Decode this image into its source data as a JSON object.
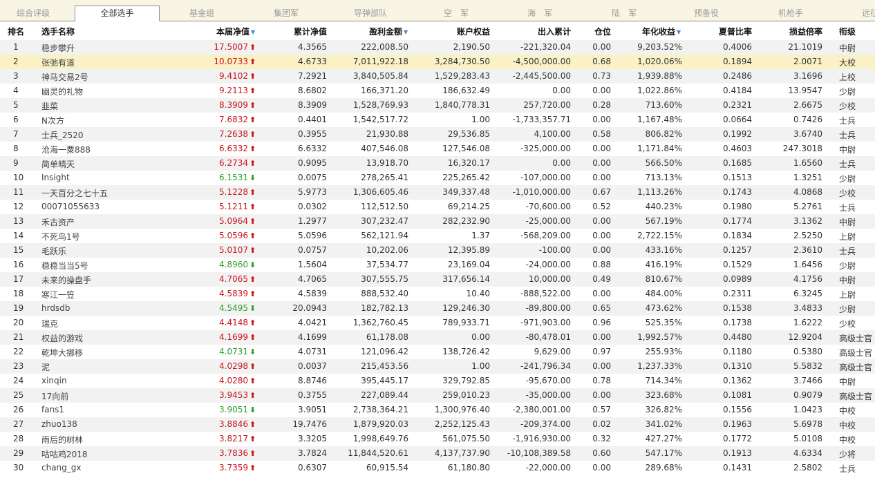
{
  "tabs": [
    {
      "label": "综合评级",
      "active": false
    },
    {
      "label": "全部选手",
      "active": true
    },
    {
      "label": "基金组",
      "active": false
    },
    {
      "label": "集团军",
      "active": false
    },
    {
      "label": "导弹部队",
      "active": false
    },
    {
      "label": "空　军",
      "active": false
    },
    {
      "label": "海　军",
      "active": false
    },
    {
      "label": "陆　军",
      "active": false
    },
    {
      "label": "预备役",
      "active": false
    },
    {
      "label": "机枪手",
      "active": false
    },
    {
      "label": "远征",
      "active": false
    }
  ],
  "columns": {
    "rank": "排名",
    "name": "选手名称",
    "nav": "本届净值",
    "cum_nav": "累计净值",
    "profit": "盈利金额",
    "equity": "账户权益",
    "withdraw": "出入累计",
    "position": "仓位",
    "annual": "年化收益",
    "sharpe": "夏普比率",
    "pl_ratio": "损益倍率",
    "rank_title": "衔级"
  },
  "sorted_columns": [
    "nav",
    "profit",
    "annual"
  ],
  "colors": {
    "up": "#c8161d",
    "down": "#2e9e2e",
    "highlight": "#fbf1c6",
    "sort": "#3c8dde"
  },
  "rows": [
    {
      "rank": "1",
      "name": "稳步攀升",
      "nav": "17.5007",
      "trend": "up",
      "cum_nav": "4.3565",
      "profit": "222,008.50",
      "equity": "2,190.50",
      "withdraw": "-221,320.04",
      "position": "0.00",
      "annual": "9,203.52%",
      "sharpe": "0.4006",
      "pl_ratio": "21.1019",
      "rank_title": "中尉"
    },
    {
      "rank": "2",
      "name": "张弛有道",
      "nav": "10.0733",
      "trend": "up",
      "cum_nav": "4.6733",
      "profit": "7,011,922.18",
      "equity": "3,284,730.50",
      "withdraw": "-4,500,000.00",
      "position": "0.68",
      "annual": "1,020.06%",
      "sharpe": "0.1894",
      "pl_ratio": "2.0071",
      "rank_title": "大校"
    },
    {
      "rank": "3",
      "name": "神马交易2号",
      "nav": "9.4102",
      "trend": "up",
      "cum_nav": "7.2921",
      "profit": "3,840,505.84",
      "equity": "1,529,283.43",
      "withdraw": "-2,445,500.00",
      "position": "0.73",
      "annual": "1,939.88%",
      "sharpe": "0.2486",
      "pl_ratio": "3.1696",
      "rank_title": "上校"
    },
    {
      "rank": "4",
      "name": "幽灵的礼物",
      "nav": "9.2113",
      "trend": "up",
      "cum_nav": "8.6802",
      "profit": "166,371.20",
      "equity": "186,632.49",
      "withdraw": "0.00",
      "position": "0.00",
      "annual": "1,022.86%",
      "sharpe": "0.4184",
      "pl_ratio": "13.9547",
      "rank_title": "少尉"
    },
    {
      "rank": "5",
      "name": "韭菜",
      "nav": "8.3909",
      "trend": "up",
      "cum_nav": "8.3909",
      "profit": "1,528,769.93",
      "equity": "1,840,778.31",
      "withdraw": "257,720.00",
      "position": "0.28",
      "annual": "713.60%",
      "sharpe": "0.2321",
      "pl_ratio": "2.6675",
      "rank_title": "少校"
    },
    {
      "rank": "6",
      "name": "N次方",
      "nav": "7.6832",
      "trend": "up",
      "cum_nav": "0.4401",
      "profit": "1,542,517.72",
      "equity": "1.00",
      "withdraw": "-1,733,357.71",
      "position": "0.00",
      "annual": "1,167.48%",
      "sharpe": "0.0664",
      "pl_ratio": "0.7426",
      "rank_title": "士兵"
    },
    {
      "rank": "7",
      "name": "士兵_2520",
      "nav": "7.2638",
      "trend": "up",
      "cum_nav": "0.3955",
      "profit": "21,930.88",
      "equity": "29,536.85",
      "withdraw": "4,100.00",
      "position": "0.58",
      "annual": "806.82%",
      "sharpe": "0.1992",
      "pl_ratio": "3.6740",
      "rank_title": "士兵"
    },
    {
      "rank": "8",
      "name": "沧海一粟888",
      "nav": "6.6332",
      "trend": "up",
      "cum_nav": "6.6332",
      "profit": "407,546.08",
      "equity": "127,546.08",
      "withdraw": "-325,000.00",
      "position": "0.00",
      "annual": "1,171.84%",
      "sharpe": "0.4603",
      "pl_ratio": "247.3018",
      "rank_title": "中尉"
    },
    {
      "rank": "9",
      "name": "简单晴天",
      "nav": "6.2734",
      "trend": "up",
      "cum_nav": "0.9095",
      "profit": "13,918.70",
      "equity": "16,320.17",
      "withdraw": "0.00",
      "position": "0.00",
      "annual": "566.50%",
      "sharpe": "0.1685",
      "pl_ratio": "1.6560",
      "rank_title": "士兵"
    },
    {
      "rank": "10",
      "name": "Insight",
      "nav": "6.1531",
      "trend": "down",
      "cum_nav": "0.0075",
      "profit": "278,265.41",
      "equity": "225,265.42",
      "withdraw": "-107,000.00",
      "position": "0.00",
      "annual": "713.13%",
      "sharpe": "0.1513",
      "pl_ratio": "1.3251",
      "rank_title": "少尉"
    },
    {
      "rank": "11",
      "name": "一天百分之七十五",
      "nav": "5.1228",
      "trend": "up",
      "cum_nav": "5.9773",
      "profit": "1,306,605.46",
      "equity": "349,337.48",
      "withdraw": "-1,010,000.00",
      "position": "0.67",
      "annual": "1,113.26%",
      "sharpe": "0.1743",
      "pl_ratio": "4.0868",
      "rank_title": "少校"
    },
    {
      "rank": "12",
      "name": "00071055633",
      "nav": "5.1211",
      "trend": "up",
      "cum_nav": "0.0302",
      "profit": "112,512.50",
      "equity": "69,214.25",
      "withdraw": "-70,600.00",
      "position": "0.52",
      "annual": "440.23%",
      "sharpe": "0.1980",
      "pl_ratio": "5.2761",
      "rank_title": "士兵"
    },
    {
      "rank": "13",
      "name": "禾古资产",
      "nav": "5.0964",
      "trend": "up",
      "cum_nav": "1.2977",
      "profit": "307,232.47",
      "equity": "282,232.90",
      "withdraw": "-25,000.00",
      "position": "0.00",
      "annual": "567.19%",
      "sharpe": "0.1774",
      "pl_ratio": "3.1362",
      "rank_title": "中尉"
    },
    {
      "rank": "14",
      "name": "不死鸟1号",
      "nav": "5.0596",
      "trend": "up",
      "cum_nav": "5.0596",
      "profit": "562,121.94",
      "equity": "1.37",
      "withdraw": "-568,209.00",
      "position": "0.00",
      "annual": "2,722.15%",
      "sharpe": "0.1834",
      "pl_ratio": "2.5250",
      "rank_title": "上尉"
    },
    {
      "rank": "15",
      "name": "毛跃乐",
      "nav": "5.0107",
      "trend": "up",
      "cum_nav": "0.0757",
      "profit": "10,202.06",
      "equity": "12,395.89",
      "withdraw": "-100.00",
      "position": "0.00",
      "annual": "433.16%",
      "sharpe": "0.1257",
      "pl_ratio": "2.3610",
      "rank_title": "士兵"
    },
    {
      "rank": "16",
      "name": "稳稳当当5号",
      "nav": "4.8960",
      "trend": "down",
      "cum_nav": "1.5604",
      "profit": "37,534.77",
      "equity": "23,169.04",
      "withdraw": "-24,000.00",
      "position": "0.88",
      "annual": "416.19%",
      "sharpe": "0.1529",
      "pl_ratio": "1.6456",
      "rank_title": "少尉"
    },
    {
      "rank": "17",
      "name": "未来的操盘手",
      "nav": "4.7065",
      "trend": "up",
      "cum_nav": "4.7065",
      "profit": "307,555.75",
      "equity": "317,656.14",
      "withdraw": "10,000.00",
      "position": "0.49",
      "annual": "810.67%",
      "sharpe": "0.0989",
      "pl_ratio": "4.1756",
      "rank_title": "中尉"
    },
    {
      "rank": "18",
      "name": "寒江一笠",
      "nav": "4.5839",
      "trend": "up",
      "cum_nav": "4.5839",
      "profit": "888,532.40",
      "equity": "10.40",
      "withdraw": "-888,522.00",
      "position": "0.00",
      "annual": "484.00%",
      "sharpe": "0.2311",
      "pl_ratio": "6.3245",
      "rank_title": "上尉"
    },
    {
      "rank": "19",
      "name": "hrdsdb",
      "nav": "4.5495",
      "trend": "down",
      "cum_nav": "20.0943",
      "profit": "182,782.13",
      "equity": "129,246.30",
      "withdraw": "-89,800.00",
      "position": "0.65",
      "annual": "473.62%",
      "sharpe": "0.1538",
      "pl_ratio": "3.4833",
      "rank_title": "少尉"
    },
    {
      "rank": "20",
      "name": "瑞克",
      "nav": "4.4148",
      "trend": "up",
      "cum_nav": "4.0421",
      "profit": "1,362,760.45",
      "equity": "789,933.71",
      "withdraw": "-971,903.00",
      "position": "0.96",
      "annual": "525.35%",
      "sharpe": "0.1738",
      "pl_ratio": "1.6222",
      "rank_title": "少校"
    },
    {
      "rank": "21",
      "name": "权益的游戏",
      "nav": "4.1699",
      "trend": "up",
      "cum_nav": "4.1699",
      "profit": "61,178.08",
      "equity": "0.00",
      "withdraw": "-80,478.01",
      "position": "0.00",
      "annual": "1,992.57%",
      "sharpe": "0.4480",
      "pl_ratio": "12.9204",
      "rank_title": "高级士官"
    },
    {
      "rank": "22",
      "name": "乾坤大挪移",
      "nav": "4.0731",
      "trend": "down",
      "cum_nav": "4.0731",
      "profit": "121,096.42",
      "equity": "138,726.42",
      "withdraw": "9,629.00",
      "position": "0.97",
      "annual": "255.93%",
      "sharpe": "0.1180",
      "pl_ratio": "0.5380",
      "rank_title": "高级士官"
    },
    {
      "rank": "23",
      "name": "泥",
      "nav": "4.0298",
      "trend": "up",
      "cum_nav": "0.0037",
      "profit": "215,453.56",
      "equity": "1.00",
      "withdraw": "-241,796.34",
      "position": "0.00",
      "annual": "1,237.33%",
      "sharpe": "0.1310",
      "pl_ratio": "5.5832",
      "rank_title": "高级士官"
    },
    {
      "rank": "24",
      "name": "xinqin",
      "nav": "4.0280",
      "trend": "up",
      "cum_nav": "8.8746",
      "profit": "395,445.17",
      "equity": "329,792.85",
      "withdraw": "-95,670.00",
      "position": "0.78",
      "annual": "714.34%",
      "sharpe": "0.1362",
      "pl_ratio": "3.7466",
      "rank_title": "中尉"
    },
    {
      "rank": "25",
      "name": "17向前",
      "nav": "3.9453",
      "trend": "up",
      "cum_nav": "0.3755",
      "profit": "227,089.44",
      "equity": "259,010.23",
      "withdraw": "-35,000.00",
      "position": "0.00",
      "annual": "323.68%",
      "sharpe": "0.1081",
      "pl_ratio": "0.9079",
      "rank_title": "高级士官"
    },
    {
      "rank": "26",
      "name": "fans1",
      "nav": "3.9051",
      "trend": "down",
      "cum_nav": "3.9051",
      "profit": "2,738,364.21",
      "equity": "1,300,976.40",
      "withdraw": "-2,380,001.00",
      "position": "0.57",
      "annual": "326.82%",
      "sharpe": "0.1556",
      "pl_ratio": "1.0423",
      "rank_title": "中校"
    },
    {
      "rank": "27",
      "name": "zhuo138",
      "nav": "3.8846",
      "trend": "up",
      "cum_nav": "19.7476",
      "profit": "1,879,920.03",
      "equity": "2,252,125.43",
      "withdraw": "-209,374.00",
      "position": "0.02",
      "annual": "341.02%",
      "sharpe": "0.1963",
      "pl_ratio": "5.6978",
      "rank_title": "中校"
    },
    {
      "rank": "28",
      "name": "雨后的树林",
      "nav": "3.8217",
      "trend": "up",
      "cum_nav": "3.3205",
      "profit": "1,998,649.76",
      "equity": "561,075.50",
      "withdraw": "-1,916,930.00",
      "position": "0.32",
      "annual": "427.27%",
      "sharpe": "0.1772",
      "pl_ratio": "5.0108",
      "rank_title": "中校"
    },
    {
      "rank": "29",
      "name": "咕咕鸡2018",
      "nav": "3.7836",
      "trend": "up",
      "cum_nav": "3.7824",
      "profit": "11,844,520.61",
      "equity": "4,137,737.90",
      "withdraw": "-10,108,389.58",
      "position": "0.60",
      "annual": "547.17%",
      "sharpe": "0.1913",
      "pl_ratio": "4.6334",
      "rank_title": "少将"
    },
    {
      "rank": "30",
      "name": "chang_gx",
      "nav": "3.7359",
      "trend": "up",
      "cum_nav": "0.6307",
      "profit": "60,915.54",
      "equity": "61,180.80",
      "withdraw": "-22,000.00",
      "position": "0.00",
      "annual": "289.68%",
      "sharpe": "0.1431",
      "pl_ratio": "2.5802",
      "rank_title": "士兵"
    }
  ]
}
